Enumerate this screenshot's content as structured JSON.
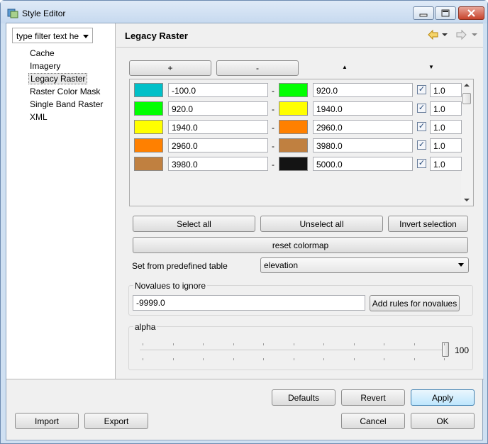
{
  "window": {
    "title": "Style Editor"
  },
  "filter": {
    "placeholder": "type filter text he"
  },
  "tree": {
    "items": [
      "Cache",
      "Imagery",
      "Legacy Raster",
      "Raster Color Mask",
      "Single Band Raster",
      "XML"
    ],
    "selected": "Legacy Raster"
  },
  "page": {
    "title": "Legacy Raster"
  },
  "table_buttons": {
    "add": "+",
    "remove": "-",
    "up": "▲",
    "down": "▼"
  },
  "colormap": {
    "rows": [
      {
        "from_color": "#00c0c8",
        "from_value": "-100.0",
        "to_color": "#00ff00",
        "to_value": "920.0",
        "checked": true,
        "opacity": "1.0"
      },
      {
        "from_color": "#00ff00",
        "from_value": "920.0",
        "to_color": "#ffff00",
        "to_value": "1940.0",
        "checked": true,
        "opacity": "1.0"
      },
      {
        "from_color": "#ffff00",
        "from_value": "1940.0",
        "to_color": "#ff8000",
        "to_value": "2960.0",
        "checked": true,
        "opacity": "1.0"
      },
      {
        "from_color": "#ff8000",
        "from_value": "2960.0",
        "to_color": "#c08040",
        "to_value": "3980.0",
        "checked": true,
        "opacity": "1.0"
      },
      {
        "from_color": "#c08040",
        "from_value": "3980.0",
        "to_color": "#141414",
        "to_value": "5000.0",
        "checked": true,
        "opacity": "1.0"
      }
    ],
    "separator": "-",
    "check_glyph": "✓"
  },
  "selection_buttons": {
    "select_all": "Select all",
    "unselect_all": "Unselect all",
    "invert": "Invert selection"
  },
  "reset_label": "reset colormap",
  "predefined": {
    "label": "Set from predefined table",
    "value": "elevation"
  },
  "novalues": {
    "group_label": "Novalues to ignore",
    "value": "-9999.0",
    "button": "Add rules for novalues"
  },
  "alpha": {
    "group_label": "alpha",
    "value": "100"
  },
  "footer": {
    "defaults": "Defaults",
    "revert": "Revert",
    "apply": "Apply",
    "import": "Import",
    "export": "Export",
    "cancel": "Cancel",
    "ok": "OK"
  }
}
